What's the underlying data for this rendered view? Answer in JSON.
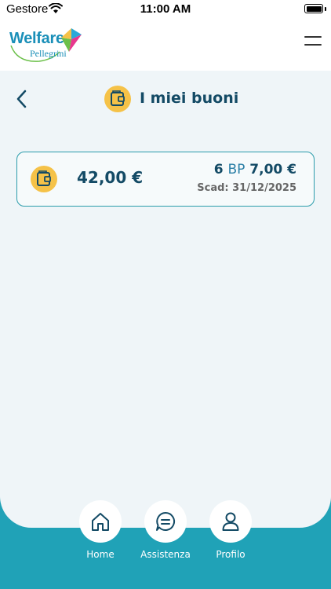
{
  "status_bar": {
    "carrier": "Gestore",
    "time": "11:00 AM"
  },
  "header": {
    "logo_main": "Welfare",
    "logo_sub": "Pellegrini"
  },
  "page": {
    "title": "I miei buoni"
  },
  "voucher": {
    "total": "42,00 €",
    "count": "6",
    "unit": "BP",
    "unit_value": "7,00 €",
    "expiry": "Scad: 31/12/2025"
  },
  "nav": {
    "home_label": "Home",
    "assist_label": "Assistenza",
    "profile_label": "Profilo"
  },
  "colors": {
    "primary": "#134a65",
    "accent": "#20a2b7",
    "icon_bg": "#f5c248",
    "background": "#eff5f8"
  }
}
